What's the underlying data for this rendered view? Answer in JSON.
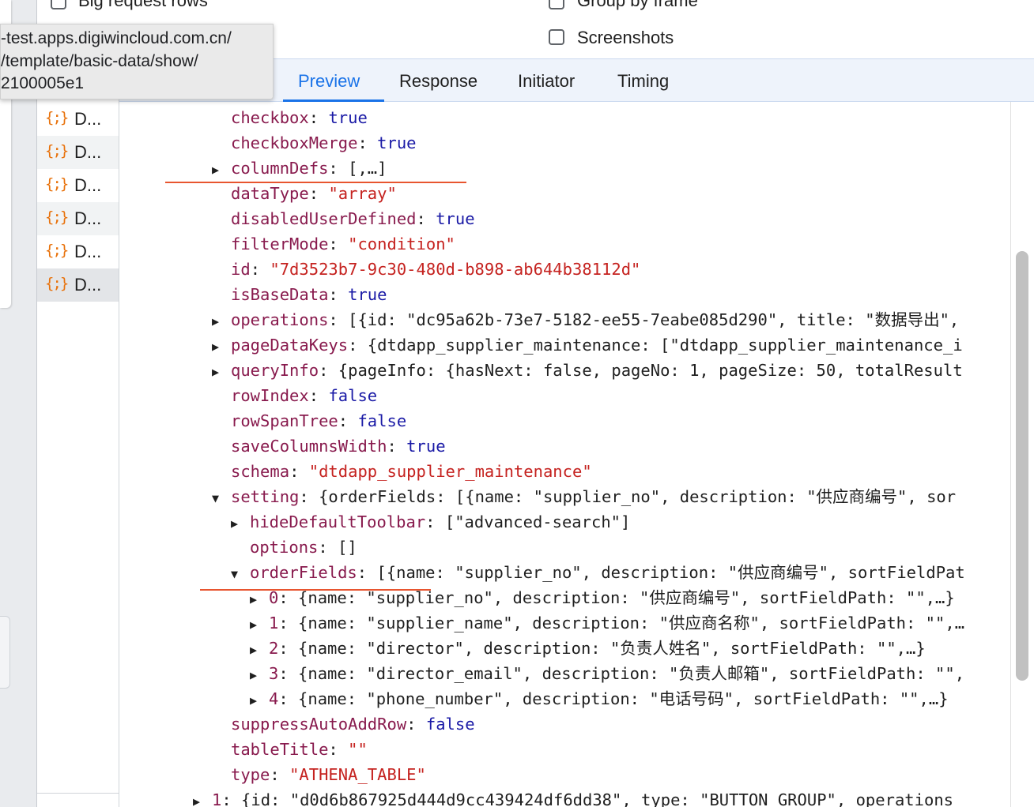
{
  "options": {
    "big_request_rows": "Big request rows",
    "group_by_frame": "Group by frame",
    "screenshots": "Screenshots"
  },
  "tabs": [
    {
      "label": "Preview",
      "active": true
    },
    {
      "label": "Response"
    },
    {
      "label": "Initiator"
    },
    {
      "label": "Timing"
    }
  ],
  "tooltip": {
    "lines": [
      "-test.apps.digiwincloud.com.cn/",
      "/template/basic-data/show/",
      "2100005e1"
    ]
  },
  "requests": [
    {
      "icon": "{;}",
      "label": "D..."
    },
    {
      "icon": "{;}",
      "label": "D..."
    },
    {
      "icon": "{;}",
      "label": "D..."
    },
    {
      "icon": "{;}",
      "label": "D..."
    },
    {
      "icon": "{;}",
      "label": "D..."
    },
    {
      "icon": "{;}",
      "label": "D..."
    }
  ],
  "preview": {
    "checkbox": {
      "key": "checkbox",
      "value": "true"
    },
    "checkboxMerge": {
      "key": "checkboxMerge",
      "value": "true"
    },
    "columnDefs": {
      "key": "columnDefs",
      "value": "[,…]"
    },
    "dataType": {
      "key": "dataType",
      "value": "\"array\""
    },
    "disabledUserDefined": {
      "key": "disabledUserDefined",
      "value": "true"
    },
    "filterMode": {
      "key": "filterMode",
      "value": "\"condition\""
    },
    "id": {
      "key": "id",
      "value": "\"7d3523b7-9c30-480d-b898-ab644b38112d\""
    },
    "isBaseData": {
      "key": "isBaseData",
      "value": "true"
    },
    "operations": {
      "key": "operations",
      "value": "[{id: \"dc95a62b-73e7-5182-ee55-7eabe085d290\", title: \"数据导出\","
    },
    "pageDataKeys": {
      "key": "pageDataKeys",
      "value": "{dtdapp_supplier_maintenance: [\"dtdapp_supplier_maintenance_i"
    },
    "queryInfo": {
      "key": "queryInfo",
      "value": "{pageInfo: {hasNext: false, pageNo: 1, pageSize: 50, totalResult"
    },
    "rowIndex": {
      "key": "rowIndex",
      "value": "false"
    },
    "rowSpanTree": {
      "key": "rowSpanTree",
      "value": "false"
    },
    "saveColumnsWidth": {
      "key": "saveColumnsWidth",
      "value": "true"
    },
    "schema": {
      "key": "schema",
      "value": "\"dtdapp_supplier_maintenance\""
    },
    "setting": {
      "key": "setting",
      "value": "{orderFields: [{name: \"supplier_no\", description: \"供应商编号\", sor"
    },
    "hideDefaultToolbar": {
      "key": "hideDefaultToolbar",
      "value": "[\"advanced-search\"]"
    },
    "options": {
      "key": "options",
      "value": "[]"
    },
    "orderFields": {
      "key": "orderFields",
      "value": "[{name: \"supplier_no\", description: \"供应商编号\", sortFieldPat"
    },
    "orderItems": [
      {
        "key": "0",
        "value": "{name: \"supplier_no\", description: \"供应商编号\", sortFieldPath: \"\",…}"
      },
      {
        "key": "1",
        "value": "{name: \"supplier_name\", description: \"供应商名称\", sortFieldPath: \"\",…"
      },
      {
        "key": "2",
        "value": "{name: \"director\", description: \"负责人姓名\", sortFieldPath: \"\",…}"
      },
      {
        "key": "3",
        "value": "{name: \"director_email\", description: \"负责人邮箱\", sortFieldPath: \"\","
      },
      {
        "key": "4",
        "value": "{name: \"phone_number\", description: \"电话号码\", sortFieldPath: \"\",…}"
      }
    ],
    "suppressAutoAddRow": {
      "key": "suppressAutoAddRow",
      "value": "false"
    },
    "tableTitle": {
      "key": "tableTitle",
      "value": "\"\""
    },
    "type": {
      "key": "type",
      "value": "\"ATHENA_TABLE\""
    },
    "next": {
      "key": "1",
      "value": "{id: \"d0d6b867925d444d9cc439424df6dd38\", type: \"BUTTON_GROUP\", operations"
    }
  },
  "colors": {
    "accent": "#1a73e8",
    "key": "#881a4d",
    "string": "#c5221f",
    "literal": "#1a1aa6",
    "annotation": "#e8552f"
  }
}
